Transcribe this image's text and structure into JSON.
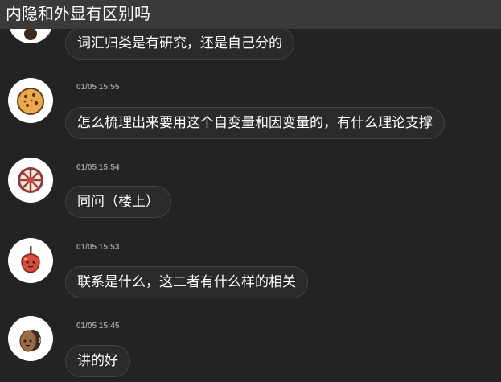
{
  "title": "内隐和外显有区别吗",
  "messages": [
    {
      "time": "",
      "text": "词汇归类是有研究，还是自己分的",
      "avatar_icon": "dark-cookie-icon"
    },
    {
      "time": "01/05 15:55",
      "text": "怎么梳理出来要用这个自变量和因变量的，有什么理论支撑",
      "avatar_icon": "cookie-icon"
    },
    {
      "time": "01/05 15:54",
      "text": "同问（楼上）",
      "avatar_icon": "candy-wheel-icon"
    },
    {
      "time": "01/05 15:53",
      "text": "联系是什么，这二者有什么样的相关",
      "avatar_icon": "candy-apple-icon"
    },
    {
      "time": "01/05 15:45",
      "text": "讲的好",
      "avatar_icon": "chocolate-egg-icon"
    }
  ],
  "colors": {
    "background": "#232323",
    "title_bar": "#3a3a3a",
    "bubble": "#2a2a2a",
    "bubble_border": "#444444",
    "timestamp": "#9a9a9a"
  }
}
